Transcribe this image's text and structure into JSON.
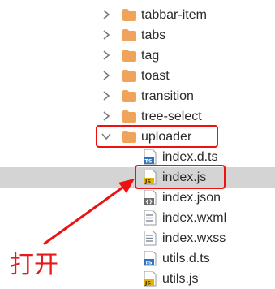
{
  "file_tree": {
    "items": [
      {
        "label": "tabbar-item",
        "kind": "folder",
        "expanded": false,
        "icon": "folder-icon",
        "selected": false
      },
      {
        "label": "tabs",
        "kind": "folder",
        "expanded": false,
        "icon": "folder-icon",
        "selected": false
      },
      {
        "label": "tag",
        "kind": "folder",
        "expanded": false,
        "icon": "folder-icon",
        "selected": false
      },
      {
        "label": "toast",
        "kind": "folder",
        "expanded": false,
        "icon": "folder-icon",
        "selected": false
      },
      {
        "label": "transition",
        "kind": "folder",
        "expanded": false,
        "icon": "folder-icon",
        "selected": false
      },
      {
        "label": "tree-select",
        "kind": "folder",
        "expanded": false,
        "icon": "folder-icon",
        "selected": false
      },
      {
        "label": "uploader",
        "kind": "folder",
        "expanded": true,
        "icon": "folder-icon",
        "selected": false
      },
      {
        "label": "index.d.ts",
        "kind": "file",
        "icon": "typescript-file-icon",
        "badge": "TS",
        "selected": false
      },
      {
        "label": "index.js",
        "kind": "file",
        "icon": "javascript-file-icon",
        "badge": "JS",
        "selected": true
      },
      {
        "label": "index.json",
        "kind": "file",
        "icon": "json-file-icon",
        "badge": "{}",
        "selected": false
      },
      {
        "label": "index.wxml",
        "kind": "file",
        "icon": "text-file-icon",
        "selected": false
      },
      {
        "label": "index.wxss",
        "kind": "file",
        "icon": "text-file-icon",
        "selected": false
      },
      {
        "label": "utils.d.ts",
        "kind": "file",
        "icon": "typescript-file-icon",
        "badge": "TS",
        "selected": false
      },
      {
        "label": "utils.js",
        "kind": "file",
        "icon": "javascript-file-icon",
        "badge": "JS",
        "selected": false
      }
    ]
  },
  "annotation": {
    "text": "打开",
    "color": "#ee1111"
  },
  "colors": {
    "folder": "#f0a35a",
    "selection": "#d4d4d4",
    "text": "#2a2a2a",
    "chevron": "#7a7a7a",
    "ts_badge": "#2f74c0",
    "js_badge": "#e5b300"
  }
}
